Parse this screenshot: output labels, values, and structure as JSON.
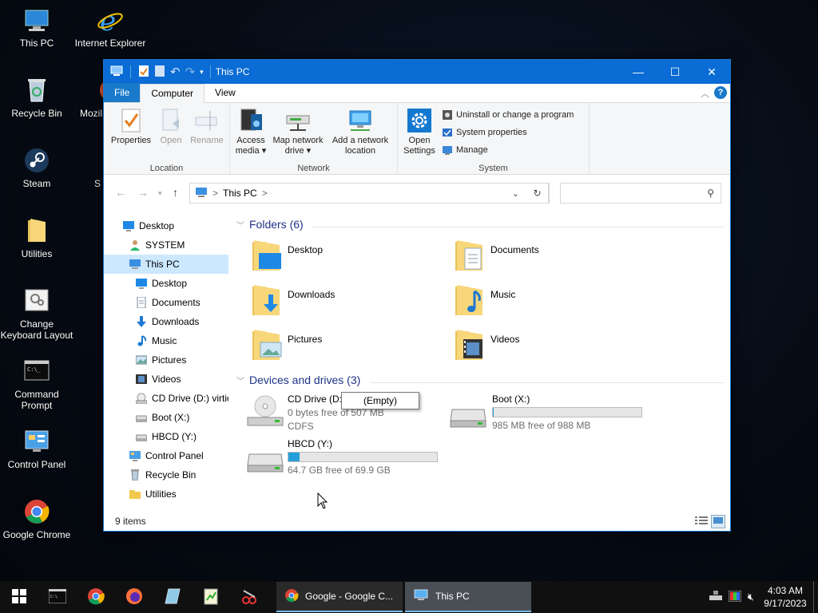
{
  "desktop": {
    "icons": [
      {
        "label": "This PC",
        "icon": "computer-icon"
      },
      {
        "label": "Internet Explorer",
        "icon": "internet-explorer-icon"
      },
      {
        "label": "Recycle Bin",
        "icon": "recycle-bin-icon"
      },
      {
        "label": "Mozil",
        "icon": "firefox-icon"
      },
      {
        "label": "Steam",
        "icon": "steam-icon"
      },
      {
        "label": "S",
        "icon": "unknown-icon"
      },
      {
        "label": "Utilities",
        "icon": "folder-icon"
      },
      {
        "label": "Change Keyboard Layout",
        "icon": "keyboard-layout-icon"
      },
      {
        "label": "Command Prompt",
        "icon": "command-prompt-icon"
      },
      {
        "label": "Control Panel",
        "icon": "control-panel-icon"
      },
      {
        "label": "Google Chrome",
        "icon": "chrome-icon"
      }
    ]
  },
  "window": {
    "title": "This PC",
    "tabs": {
      "file": "File",
      "computer": "Computer",
      "view": "View"
    },
    "ribbon": {
      "location": {
        "label": "Location",
        "properties": "Properties",
        "open": "Open",
        "rename": "Rename"
      },
      "network": {
        "label": "Network",
        "access_media_1": "Access",
        "access_media_2": "media",
        "map_drive_1": "Map network",
        "map_drive_2": "drive",
        "add_location_1": "Add a network",
        "add_location_2": "location"
      },
      "system": {
        "label": "System",
        "open_settings_1": "Open",
        "open_settings_2": "Settings",
        "uninstall": "Uninstall or change a program",
        "system_properties": "System properties",
        "manage": "Manage"
      }
    },
    "address": {
      "path": "This PC",
      "separator": ">"
    },
    "nav": [
      {
        "label": "Desktop",
        "indent": 1,
        "icon": "desktop-icon"
      },
      {
        "label": "SYSTEM",
        "indent": 2,
        "icon": "user-icon"
      },
      {
        "label": "This PC",
        "indent": 2,
        "icon": "computer-icon",
        "selected": true
      },
      {
        "label": "Desktop",
        "indent": 3,
        "icon": "desktop-icon"
      },
      {
        "label": "Documents",
        "indent": 3,
        "icon": "documents-icon"
      },
      {
        "label": "Downloads",
        "indent": 3,
        "icon": "downloads-icon"
      },
      {
        "label": "Music",
        "indent": 3,
        "icon": "music-icon"
      },
      {
        "label": "Pictures",
        "indent": 3,
        "icon": "pictures-icon"
      },
      {
        "label": "Videos",
        "indent": 3,
        "icon": "videos-icon"
      },
      {
        "label": "CD Drive (D:) virtio",
        "indent": 3,
        "icon": "cd-drive-icon"
      },
      {
        "label": "Boot (X:)",
        "indent": 3,
        "icon": "drive-icon"
      },
      {
        "label": "HBCD (Y:)",
        "indent": 3,
        "icon": "drive-icon"
      },
      {
        "label": "Control Panel",
        "indent": 2,
        "icon": "control-panel-icon"
      },
      {
        "label": "Recycle Bin",
        "indent": 2,
        "icon": "recycle-bin-icon"
      },
      {
        "label": "Utilities",
        "indent": 2,
        "icon": "folder-icon"
      }
    ],
    "folders_header": "Folders (6)",
    "folders": [
      {
        "name": "Desktop",
        "icon": "desktop-folder-icon"
      },
      {
        "name": "Documents",
        "icon": "documents-folder-icon"
      },
      {
        "name": "Downloads",
        "icon": "downloads-folder-icon"
      },
      {
        "name": "Music",
        "icon": "music-folder-icon"
      },
      {
        "name": "Pictures",
        "icon": "pictures-folder-icon"
      },
      {
        "name": "Videos",
        "icon": "videos-folder-icon"
      }
    ],
    "drives_header": "Devices and drives (3)",
    "drives": [
      {
        "name": "CD Drive (D:)",
        "space": "0 bytes free of 507 MB",
        "fs": "CDFS",
        "icon": "cd-drive-icon",
        "used_fraction": 1.0
      },
      {
        "name": "Boot (X:)",
        "space": "985 MB free of 988 MB",
        "icon": "drive-icon",
        "used_fraction": 0.003
      },
      {
        "name": "HBCD (Y:)",
        "space": "64.7 GB free of 69.9 GB",
        "icon": "drive-icon",
        "used_fraction": 0.074
      }
    ],
    "tooltip": "(Empty)",
    "status": "9 items"
  },
  "taskbar": {
    "windows": [
      {
        "label": "Google - Google C...",
        "icon": "chrome-icon"
      },
      {
        "label": "This PC",
        "icon": "computer-icon"
      }
    ],
    "time": "4:03 AM",
    "date": "9/17/2023"
  },
  "colors": {
    "accent": "#0a6cd4",
    "selection": "#cce8ff",
    "drive_bar": "#26a0da",
    "header_text": "#1e3287"
  }
}
